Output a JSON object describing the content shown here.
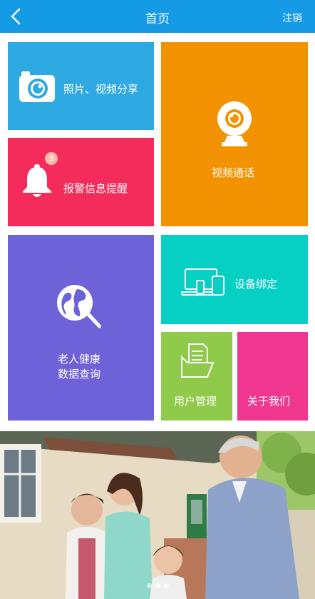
{
  "header": {
    "title": "首页",
    "logout_label": "注销"
  },
  "tiles": {
    "photo": {
      "label": "照片、视频分享",
      "icon": "camera-icon"
    },
    "alarm": {
      "label": "报警信息提醒",
      "icon": "bell-icon",
      "badge": "3"
    },
    "video": {
      "label": "视频通话",
      "icon": "webcam-icon"
    },
    "health": {
      "label_line1": "老人健康",
      "label_line2": "数据查询",
      "icon": "globe-search-icon"
    },
    "device": {
      "label": "设备绑定",
      "icon": "devices-icon"
    },
    "user": {
      "label": "用户管理",
      "icon": "folder-document-icon"
    },
    "about": {
      "label": "关于我们"
    }
  },
  "colors": {
    "header": "#159BE6",
    "photo": "#2FA9E1",
    "alarm": "#F42C5C",
    "video": "#F39200",
    "health": "#6E62D9",
    "device": "#06CFC3",
    "user": "#8FCA4A",
    "about": "#F0378F"
  },
  "banner": {
    "image": "family-photo",
    "slides": 3,
    "active_slide": 2
  }
}
